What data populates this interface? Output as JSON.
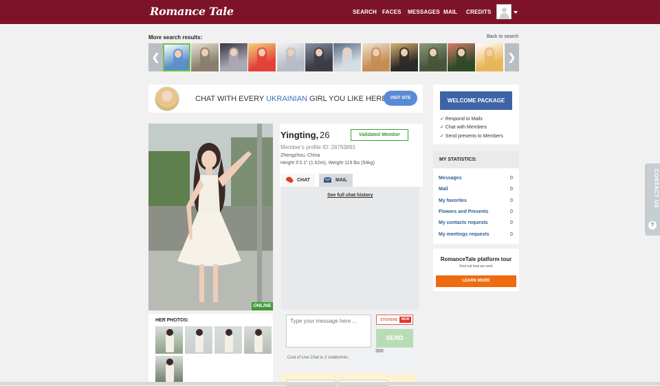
{
  "header": {
    "logo": "Romance Tale",
    "nav": [
      "SEARCH",
      "FACES",
      "MESSAGES",
      "MAIL",
      "CREDITS"
    ],
    "bg_color": "#7d1329"
  },
  "search_strip": {
    "label": "More search results:",
    "back_link": "Back to search",
    "prev_arrow": "❮",
    "next_arrow": "❯",
    "thumbnails": [
      {
        "palette": [
          "#5a8fc7",
          "#ffffff"
        ],
        "selected": true
      },
      {
        "palette": [
          "#8a7f6e",
          "#e9e0d2"
        ],
        "selected": false
      },
      {
        "palette": [
          "#a9a9b5",
          "#3a3340"
        ],
        "selected": false
      },
      {
        "palette": [
          "#e2413a",
          "#f3d37a"
        ],
        "selected": false
      },
      {
        "palette": [
          "#b7bcc7",
          "#f2f2f4"
        ],
        "selected": false
      },
      {
        "palette": [
          "#3c3c46",
          "#8a8fa3"
        ],
        "selected": false
      },
      {
        "palette": [
          "#d3dde4",
          "#5a6b82"
        ],
        "selected": false
      },
      {
        "palette": [
          "#c68c54",
          "#ede4d0"
        ],
        "selected": false
      },
      {
        "palette": [
          "#2c2a28",
          "#d8b070"
        ],
        "selected": false
      },
      {
        "palette": [
          "#48553a",
          "#8a9a7a"
        ],
        "selected": false
      },
      {
        "palette": [
          "#2f4a27",
          "#d87c6a"
        ],
        "selected": false
      },
      {
        "palette": [
          "#e8b65a",
          "#ffffff"
        ],
        "selected": false
      }
    ]
  },
  "banner": {
    "text_before": "CHAT WITH EVERY ",
    "text_highlight": "UKRAINIAN",
    "text_after": " GIRL YOU LIKE HERE!",
    "button": "VISIT SITE"
  },
  "profile": {
    "name": "Yingting,",
    "age": "26",
    "badge": "Validated Member",
    "profile_id": "Member's profile ID: 28793891",
    "location": "Zhengzhou, China",
    "height_weight": "Height 5'3.1\" (1.62m), Weight 119 lbs (54kg)",
    "status": "ONLINE",
    "photo_watermark": "Romance Tale"
  },
  "her_photos": {
    "label": "HER PHOTOS:",
    "thumbs": [
      "#8ea083",
      "#c8cfcd",
      "#cfd3d0",
      "#b6bbb5",
      "#6e7a66"
    ]
  },
  "chat": {
    "tab_chat": "CHAT",
    "tab_mail": "MAIL",
    "history_link": "See full chat history",
    "input_placeholder": "Type your message here ...",
    "stickers_label": "STICKERS",
    "stickers_new": "NEW",
    "send_label": "SEND",
    "char_count": "300",
    "cost_note": "Cost of Live Chat is 2 credits/min."
  },
  "welcome": {
    "button": "WELCOME PACKAGE",
    "items": [
      "✓ Respond to Mails",
      "✓ Chat with Members",
      "✓ Send presents to Members"
    ]
  },
  "statistics": {
    "title": "MY STATISTICS:",
    "rows": [
      {
        "label": "Messages",
        "value": "0"
      },
      {
        "label": "Mail",
        "value": "0"
      },
      {
        "label": "My favorites",
        "value": "0"
      },
      {
        "label": "Flowers and Presents",
        "value": "0"
      },
      {
        "label": "My contacts requests",
        "value": "0"
      },
      {
        "label": "My meetings requests",
        "value": "0"
      }
    ]
  },
  "tour": {
    "title": "RomanceTale platform tour",
    "subtitle": "Find out how we work",
    "button": "LEARN MORE"
  },
  "contact_tab": {
    "label": "CONTACT US",
    "icon": "?"
  }
}
